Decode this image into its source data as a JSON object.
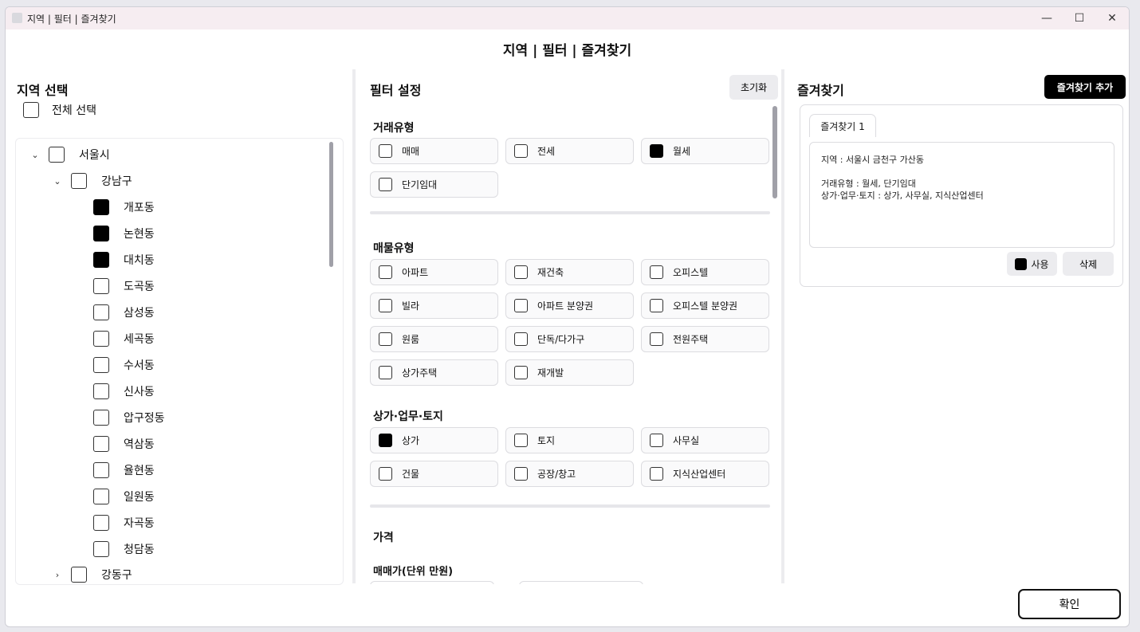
{
  "window": {
    "title": "지역 | 필터 | 즐겨찾기",
    "minimize": "—",
    "maximize": "☐",
    "close": "✕"
  },
  "header": {
    "title": "지역 | 필터 | 즐겨찾기"
  },
  "region": {
    "title": "지역 선택",
    "select_all": "전체 선택",
    "city": "서울시",
    "district": "강남구",
    "dongs": [
      {
        "label": "개포동",
        "checked": true
      },
      {
        "label": "논현동",
        "checked": true
      },
      {
        "label": "대치동",
        "checked": true
      },
      {
        "label": "도곡동",
        "checked": false
      },
      {
        "label": "삼성동",
        "checked": false
      },
      {
        "label": "세곡동",
        "checked": false
      },
      {
        "label": "수서동",
        "checked": false
      },
      {
        "label": "신사동",
        "checked": false
      },
      {
        "label": "압구정동",
        "checked": false
      },
      {
        "label": "역삼동",
        "checked": false
      },
      {
        "label": "율현동",
        "checked": false
      },
      {
        "label": "일원동",
        "checked": false
      },
      {
        "label": "자곡동",
        "checked": false
      },
      {
        "label": "청담동",
        "checked": false
      }
    ],
    "next_district": "강동구"
  },
  "filter": {
    "title": "필터 설정",
    "reset": "초기화",
    "trade_type": {
      "title": "거래유형",
      "items": [
        {
          "label": "매매",
          "checked": false
        },
        {
          "label": "전세",
          "checked": false
        },
        {
          "label": "월세",
          "checked": true
        },
        {
          "label": "단기임대",
          "checked": false
        }
      ]
    },
    "property_type": {
      "title": "매물유형",
      "items": [
        {
          "label": "아파트",
          "checked": false
        },
        {
          "label": "재건축",
          "checked": false
        },
        {
          "label": "오피스텔",
          "checked": false
        },
        {
          "label": "빌라",
          "checked": false
        },
        {
          "label": "아파트 분양권",
          "checked": false
        },
        {
          "label": "오피스텔 분양권",
          "checked": false
        },
        {
          "label": "원룸",
          "checked": false
        },
        {
          "label": "단독/다가구",
          "checked": false
        },
        {
          "label": "전원주택",
          "checked": false
        },
        {
          "label": "상가주택",
          "checked": false
        },
        {
          "label": "재개발",
          "checked": false
        }
      ]
    },
    "commercial": {
      "title": "상가·업무·토지",
      "items": [
        {
          "label": "상가",
          "checked": true
        },
        {
          "label": "토지",
          "checked": false
        },
        {
          "label": "사무실",
          "checked": false
        },
        {
          "label": "건물",
          "checked": false
        },
        {
          "label": "공장/창고",
          "checked": false
        },
        {
          "label": "지식산업센터",
          "checked": false
        }
      ]
    },
    "price": {
      "title": "가격",
      "sale_label": "매매가(단위 만원)"
    }
  },
  "favorites": {
    "title": "즐겨찾기",
    "add": "즐겨찾기 추가",
    "tab": "즐겨찾기 1",
    "region_line": "지역 : 서울시 금천구 가산동",
    "trade_line": "거래유형 : 월세, 단기임대",
    "commercial_line": "상가·업무·토지 : 상가, 사무실, 지식산업센터",
    "use": "사용",
    "use_checked": true,
    "delete": "삭제"
  },
  "confirm": "확인"
}
